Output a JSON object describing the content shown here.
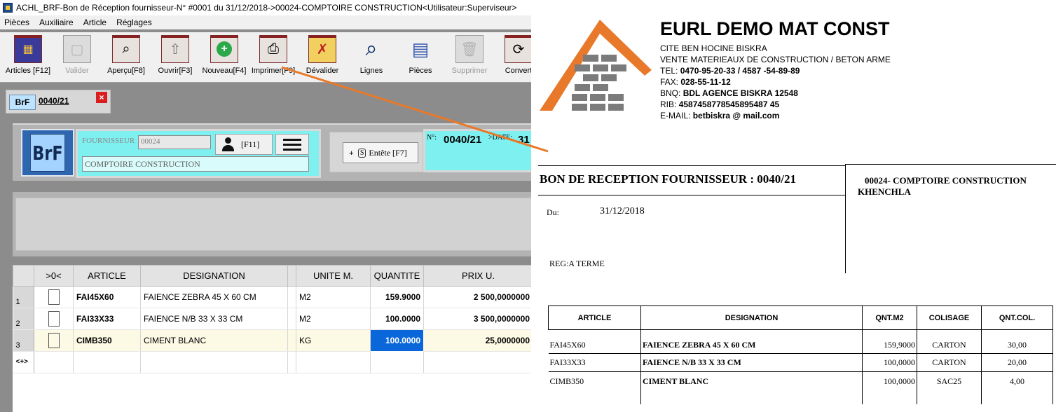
{
  "window": {
    "title": "ACHL_BRF-Bon de Réception fournisseur-N° #0001 du 31/12/2018->00024-COMPTOIRE CONSTRUCTION<Utilisateur:Superviseur>"
  },
  "menu": [
    "Pièces",
    "Auxiliaire",
    "Article",
    "Réglages"
  ],
  "toolbar": [
    {
      "label": "Articles [F12]",
      "icon": "grid-icon",
      "enabled": true
    },
    {
      "label": "Valider",
      "icon": "check-square-icon",
      "enabled": false
    },
    {
      "label": "Aperçu[F8]",
      "icon": "magnifier-icon",
      "enabled": true
    },
    {
      "label": "Ouvrir[F3]",
      "icon": "up-arrow-icon",
      "enabled": true
    },
    {
      "label": "Nouveau[F4]",
      "icon": "plus-circle-icon",
      "enabled": true
    },
    {
      "label": "Imprimer[F9]",
      "icon": "printer-icon",
      "enabled": true
    },
    {
      "label": "Dévalider",
      "icon": "uncheck-icon",
      "enabled": true
    },
    {
      "label": "Lignes",
      "icon": "search-lines-icon",
      "enabled": true
    },
    {
      "label": "Pièces",
      "icon": "documents-icon",
      "enabled": true
    },
    {
      "label": "Supprimer",
      "icon": "trash-icon",
      "enabled": false
    },
    {
      "label": "Convert",
      "icon": "convert-icon",
      "enabled": true
    }
  ],
  "doc_tab": {
    "badge": "BrF",
    "number": "0040/21",
    "close": "×"
  },
  "header": {
    "badge": "BrF",
    "fournisseur_label": "FOURNISSEUR",
    "fournisseur_code": "00024",
    "fournisseur_name": "COMPTOIRE CONSTRUCTION",
    "user_key": "[F11]",
    "entete_label": "Entête [F7]",
    "entete_plus": "+",
    "entete_s": "S",
    "num_label": "N°:",
    "num_value": "0040/21",
    "date_label": ">DATE:",
    "date_value_partial": "31"
  },
  "grid": {
    "columns": [
      "",
      ">0<",
      "ARTICLE",
      "DESIGNATION",
      "",
      "UNITE M.",
      "QUANTITE",
      "PRIX U."
    ],
    "rows": [
      {
        "n": "1",
        "article": "FAI45X60",
        "designation": "FAIENCE ZEBRA 45 X 60 CM",
        "unite": "M2",
        "quantite": "159.9000",
        "prix": "2 500,0000000"
      },
      {
        "n": "2",
        "article": "FAI33X33",
        "designation": "FAIENCE N/B 33 X 33 CM",
        "unite": "M2",
        "quantite": "100.0000",
        "prix": "3 500,0000000"
      },
      {
        "n": "3",
        "article": "CIMB350",
        "designation": "CIMENT  BLANC",
        "unite": "KG",
        "quantite": "100.0000",
        "prix": "25,0000000"
      }
    ],
    "new_row": "<+>"
  },
  "document": {
    "company": "EURL DEMO MAT CONST",
    "address": "CITE BEN HOCINE BISKRA",
    "activity": "VENTE MATERIEAUX DE CONSTRUCTION  / BETON ARME",
    "tel_label": "TEL:",
    "tel": "0470-95-20-33 / 4587 -54-89-89",
    "fax_label": "FAX:",
    "fax": "028-55-11-12",
    "bnq_label": "BNQ:",
    "bnq": "BDL AGENCE BISKRA 12548",
    "rib_label": "RIB:",
    "rib": "4587458778545895487 45",
    "email_label": "E-MAIL:",
    "email": "betbiskra @ mail.com",
    "title": "BON DE RECEPTION FOURNISSEUR : 0040/21",
    "du_label": "Du:",
    "date": "31/12/2018",
    "reg": "REG:A TERME",
    "client_line1": "00024- COMPTOIRE CONSTRUCTION",
    "client_line2": "KHENCHLA",
    "columns": [
      "ARTICLE",
      "DESIGNATION",
      "QNT.M2",
      "COLISAGE",
      "QNT.COL."
    ],
    "rows": [
      {
        "article": "FAI45X60",
        "designation": "FAIENCE ZEBRA 45 X 60 CM",
        "qnt": "159,9000",
        "colisage": "CARTON",
        "qntcol": "30,00"
      },
      {
        "article": "FAI33X33",
        "designation": "FAIENCE N/B 33 X 33 CM",
        "qnt": "100,0000",
        "colisage": "CARTON",
        "qntcol": "20,00"
      },
      {
        "article": "CIMB350",
        "designation": "CIMENT  BLANC",
        "qnt": "100,0000",
        "colisage": "SAC25",
        "qntcol": "4,00"
      }
    ]
  },
  "colors": {
    "accent_orange": "#e8792a",
    "cyan_panel": "#7ff0f0",
    "selection_blue": "#0a67d9"
  }
}
